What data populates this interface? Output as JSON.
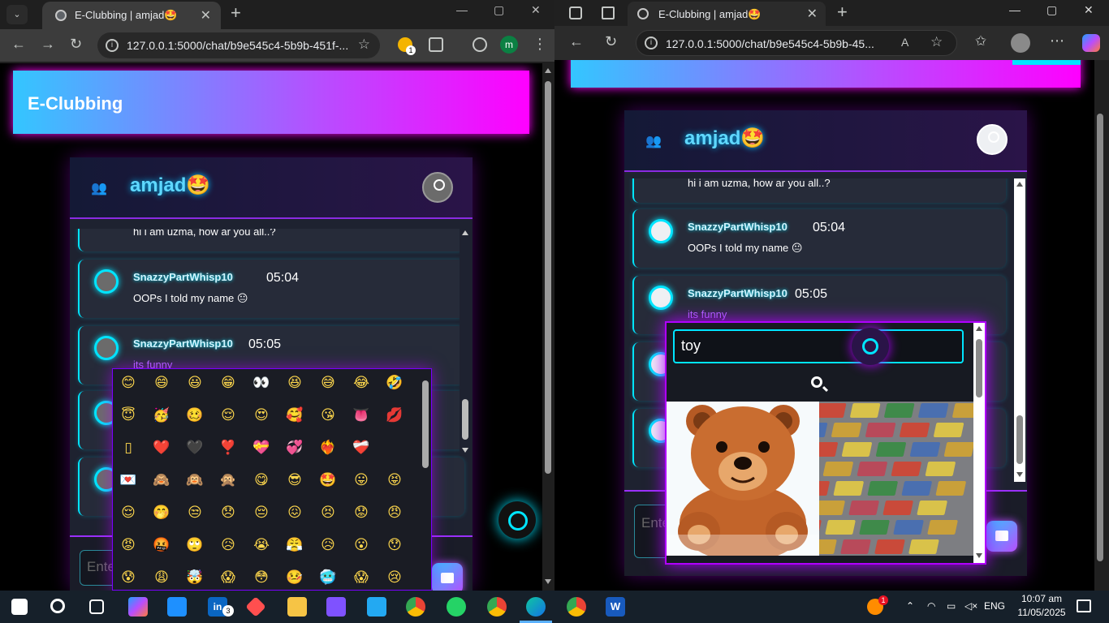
{
  "left_browser": {
    "tab_title": "E-Clubbing | amjad🤩",
    "url": "127.0.0.1:5000/chat/b9e545c4-5b9b-451f-...",
    "profile_initial": "m",
    "extension_badge": "1"
  },
  "right_browser": {
    "tab_title": "E-Clubbing | amjad🤩",
    "url": "127.0.0.1:5000/chat/b9e545c4-5b9b-45..."
  },
  "app": {
    "brand": "E-Clubbing",
    "chat_user": "amjad🤩",
    "input_placeholder": "Ente"
  },
  "messages_left": [
    {
      "text": "hi i am uzma, how ar you all..?"
    },
    {
      "user": "SnazzyPartWhisp10",
      "time": "05:04",
      "text": "OOPs I told my name 😐"
    },
    {
      "user": "SnazzyPartWhisp10",
      "time": "05:05",
      "text": "its funny"
    }
  ],
  "messages_right": [
    {
      "text": "hi i am uzma, how ar you all..?"
    },
    {
      "user": "SnazzyPartWhisp10",
      "time": "05:04",
      "text": "OOPs I told my name 😐"
    },
    {
      "user": "SnazzyPartWhisp10",
      "time": "05:05",
      "text": "its funny"
    }
  ],
  "emoji_picker": {
    "rows": [
      [
        "😊",
        "😄",
        "😃",
        "😁",
        "👀",
        "😆",
        "😅",
        "😂",
        "🤣"
      ],
      [
        "😇",
        "🥳",
        "🥴",
        "😌",
        "😍",
        "🥰",
        "😘",
        "👅",
        "💋"
      ],
      [
        "▯",
        "❤️",
        "🖤",
        "❣️",
        "💝",
        "💞",
        "❤️‍🔥",
        "❤️‍🩹",
        ""
      ],
      [
        "💌",
        "🙈",
        "🙉",
        "🙊",
        "😋",
        "😎",
        "🤩",
        "😛",
        "😝"
      ],
      [
        "😌",
        "🤭",
        "😒",
        "😞",
        "😔",
        "😖",
        "😣",
        "😟",
        "😠"
      ],
      [
        "😡",
        "🤬",
        "🙄",
        "😥",
        "😭",
        "😤",
        "😥",
        "😮",
        "😯"
      ],
      [
        "😰",
        "😩",
        "🤯",
        "😱",
        "😳",
        "🤒",
        "🥶",
        "😱",
        "😢"
      ]
    ]
  },
  "gif_picker": {
    "search_value": "toy",
    "results": [
      "teddy bear",
      "lego bricks"
    ]
  },
  "taskbar": {
    "time": "10:07 am",
    "date": "11/05/2025",
    "language": "ENG",
    "linkedin_badge": "3",
    "weather_badge": "1"
  },
  "colors": {
    "accent_cyan": "#00e5ff",
    "accent_magenta": "#ff00ff",
    "accent_purple": "#b84dff"
  }
}
